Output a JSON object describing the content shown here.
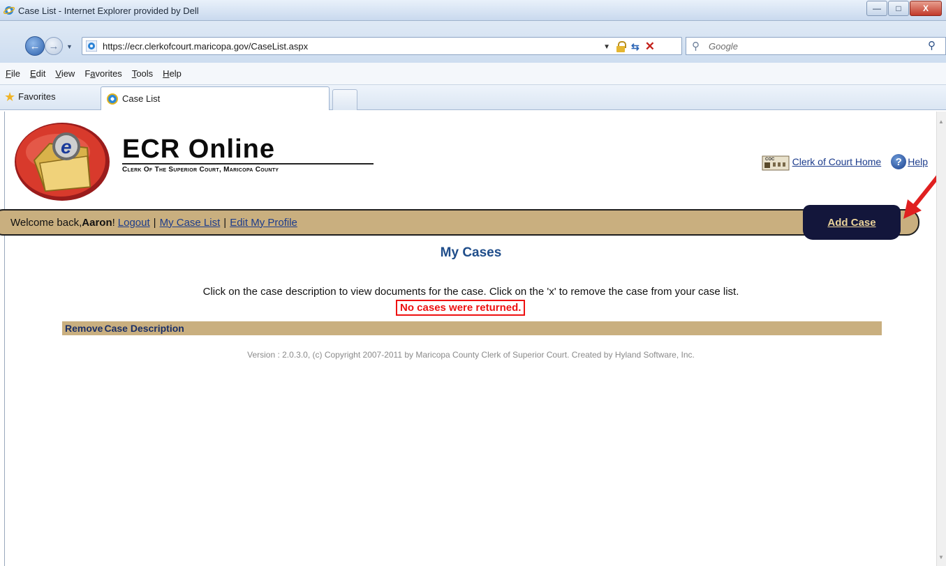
{
  "window": {
    "title": "Case List - Internet Explorer provided by Dell",
    "minimize_glyph": "—",
    "maximize_glyph": "□",
    "close_glyph": "X"
  },
  "address_bar": {
    "url": "https://ecr.clerkofcourt.maricopa.gov/CaseList.aspx"
  },
  "search": {
    "placeholder": "Google"
  },
  "menu": [
    {
      "label": "File",
      "key": "F"
    },
    {
      "label": "Edit",
      "key": "E"
    },
    {
      "label": "View",
      "key": "V"
    },
    {
      "label": "Favorites",
      "key": "a"
    },
    {
      "label": "Tools",
      "key": "T"
    },
    {
      "label": "Help",
      "key": "H"
    }
  ],
  "favorites_bar": {
    "favorites_label": "Favorites",
    "tab_label": "Case List"
  },
  "header": {
    "brand": "ECR Online",
    "subtitle": "Clerk Of The Superior Court, Maricopa County",
    "clerk_home_link": "Clerk of Court Home",
    "help_link": "Help",
    "help_glyph": "?"
  },
  "welcome": {
    "prefix": "Welcome back, ",
    "user": "Aaron",
    "suffix": "!",
    "logout": "Logout",
    "my_case_list": "My Case List",
    "edit_profile": "Edit My Profile",
    "separator": "|"
  },
  "add_case_button": "Add Case",
  "main": {
    "heading": "My Cases",
    "instructions": "Click on the case description to view documents for the case. Click on the 'x' to remove the case from your case list.",
    "no_results": "No cases were returned.",
    "table_headers": [
      "Remove",
      "Case Description"
    ],
    "version_text": "Version : 2.0.3.0, (c) Copyright 2007-2011 by Maricopa County Clerk of Superior Court. Created by Hyland Software, Inc."
  },
  "colors": {
    "tan_bar": "#c9af7f",
    "navy_button": "#13163b",
    "heading_blue": "#1f4d8a",
    "error_red": "#e11111",
    "annotation_arrow": "#e02020"
  }
}
